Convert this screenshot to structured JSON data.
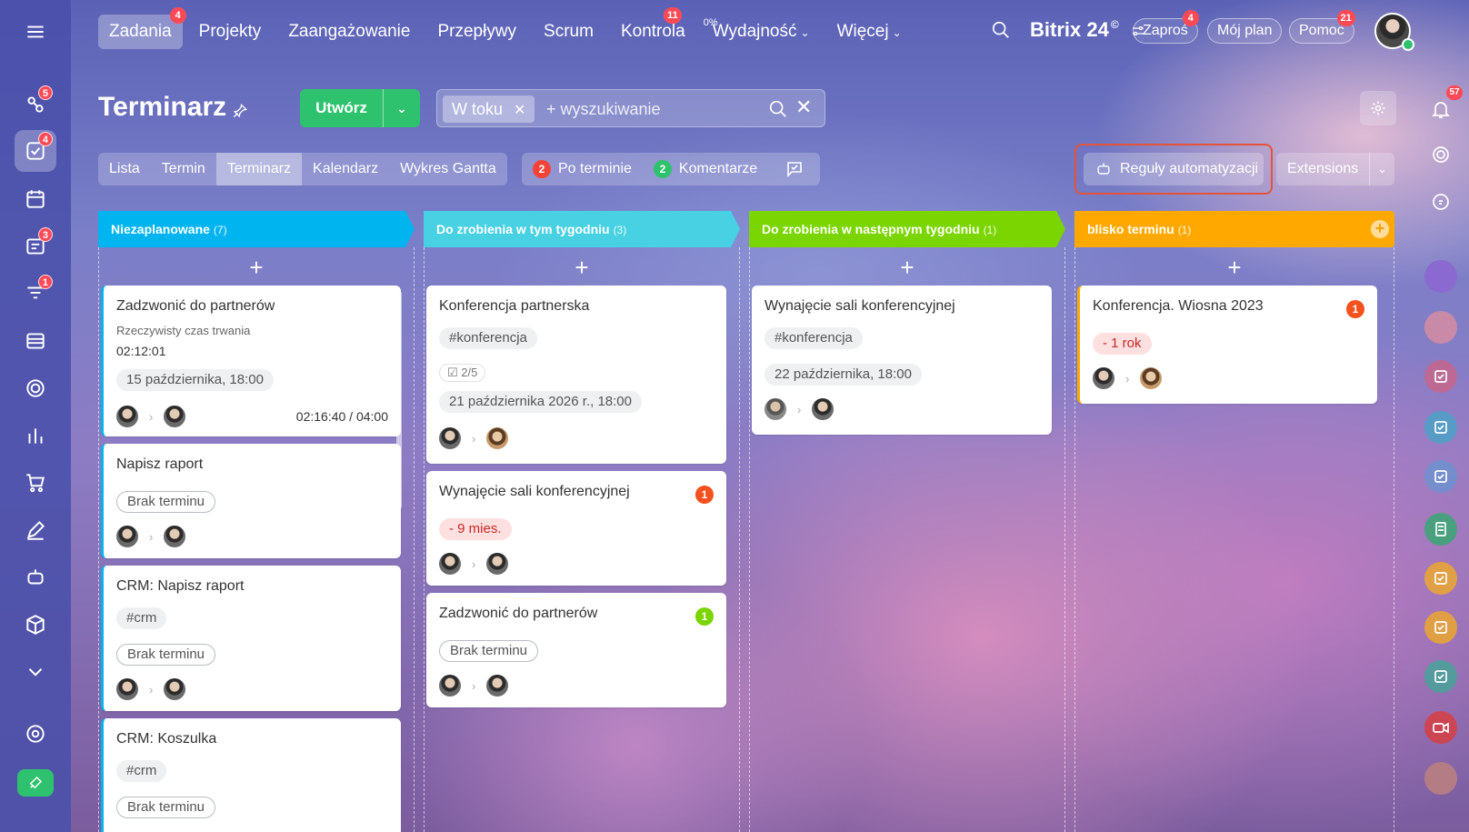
{
  "nav": {
    "items": [
      {
        "label": "Zadania",
        "badge": "4",
        "active": true
      },
      {
        "label": "Projekty"
      },
      {
        "label": "Zaangażowanie"
      },
      {
        "label": "Przepływy"
      },
      {
        "label": "Scrum"
      },
      {
        "label": "Kontrola",
        "badge": "11"
      },
      {
        "label": "Wydajność",
        "pct": "0%",
        "chevron": true
      },
      {
        "label": "Więcej",
        "chevron": true
      }
    ]
  },
  "brand": {
    "name": "Bitrix",
    "num": "24",
    "clock": "©"
  },
  "top": {
    "invite_label": "Zaproś",
    "invite_badge": "4",
    "plan_label": "Mój plan",
    "help_label": "Pomoc",
    "help_badge": "21"
  },
  "leftbar": {
    "badges": [
      "5",
      "4",
      "3",
      "1"
    ]
  },
  "page": {
    "title": "Terminarz"
  },
  "create": {
    "label": "Utwórz"
  },
  "search": {
    "filter_chip": "W toku",
    "placeholder": "+ wyszukiwanie"
  },
  "views": {
    "tabs": [
      "Lista",
      "Termin",
      "Terminarz",
      "Kalendarz",
      "Wykres Gantta"
    ],
    "active": "Terminarz"
  },
  "counters": [
    {
      "num": "2",
      "label": "Po terminie",
      "color": "#f44336"
    },
    {
      "num": "2",
      "label": "Komentarze",
      "color": "#2fc26e"
    }
  ],
  "automation": {
    "label": "Reguły automatyzacji"
  },
  "extensions": {
    "label": "Extensions"
  },
  "rightbar": {
    "notif_badge": "57"
  },
  "columns": [
    {
      "title": "Niezaplanowane",
      "count": "(7)",
      "color": "#00b4ef",
      "cards": [
        {
          "title": "Zadzwonić do partnerów",
          "sub": "Rzeczywisty czas trwania",
          "time": "02:12:01",
          "tag": "15 października, 18:00",
          "timer": "02:16:40 / 04:00"
        },
        {
          "title": "Napisz raport",
          "tag": "Brak terminu"
        },
        {
          "title": "CRM: Napisz raport",
          "hashtag": "#crm",
          "tag": "Brak terminu"
        },
        {
          "title": "CRM: Koszulka",
          "hashtag": "#crm",
          "tag": "Brak terminu"
        }
      ]
    },
    {
      "title": "Do zrobienia w tym tygodniu",
      "count": "(3)",
      "color": "#47d1e2",
      "cards": [
        {
          "title": "Konferencja partnerska",
          "hashtag": "#konferencja",
          "checklist": "2/5",
          "tag": "21 października 2026 r., 18:00"
        },
        {
          "title": "Wynajęcie sali konferencyjnej",
          "counter": "1",
          "tag": "- 9 mies."
        },
        {
          "title": "Zadzwonić do partnerów",
          "counter": "1",
          "tag": "Brak terminu"
        }
      ]
    },
    {
      "title": "Do zrobienia w następnym tygodniu",
      "count": "(1)",
      "color": "#7bd500",
      "cards": [
        {
          "title": "Wynajęcie sali konferencyjnej",
          "hashtag": "#konferencja",
          "tag": "22 października, 18:00"
        }
      ]
    },
    {
      "title": "blisko terminu",
      "count": "(1)",
      "color": "#ffa900",
      "cards": [
        {
          "title": "Konferencja. Wiosna 2023",
          "counter": "1",
          "tag": "- 1 rok"
        }
      ]
    }
  ]
}
